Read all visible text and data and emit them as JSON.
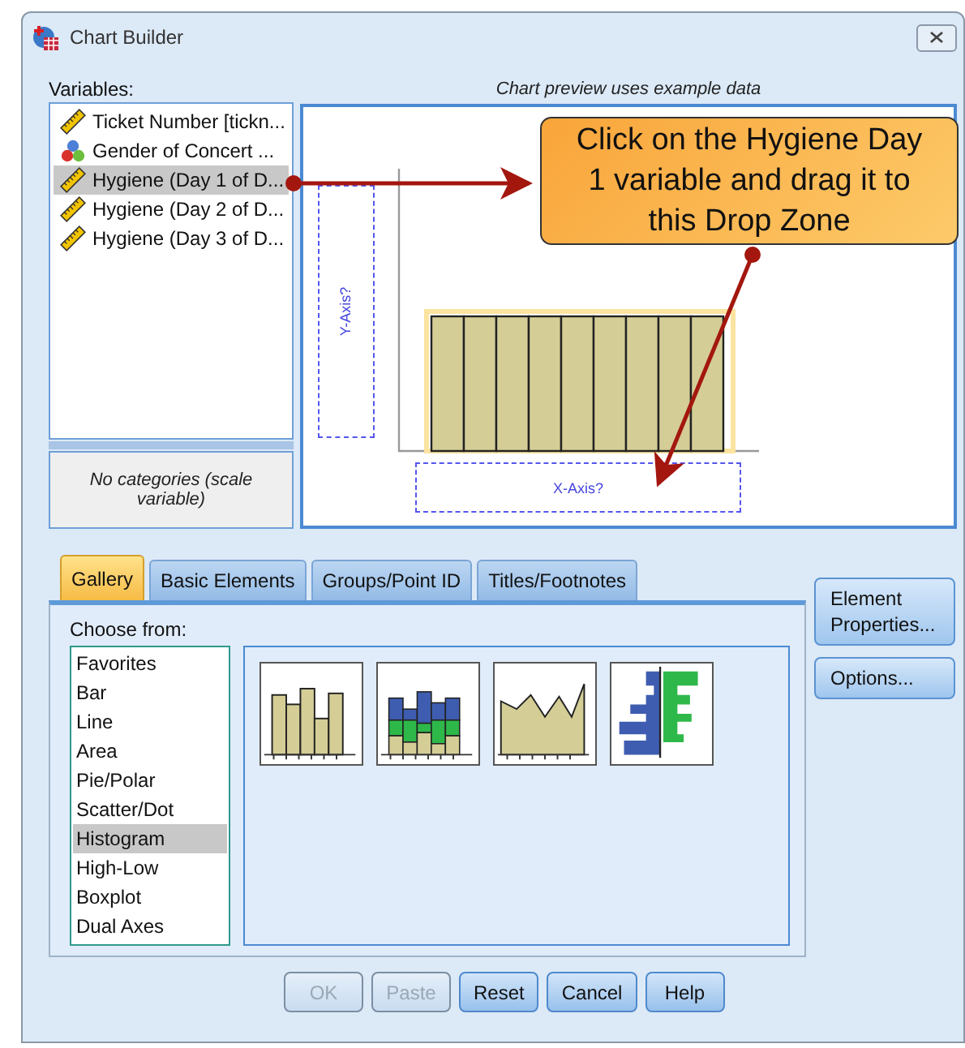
{
  "window": {
    "title": "Chart Builder"
  },
  "variables": {
    "label": "Variables:",
    "items": [
      {
        "name": "Ticket Number [tickn...",
        "kind": "scale",
        "selected": false
      },
      {
        "name": "Gender of Concert ...",
        "kind": "nominal",
        "selected": false
      },
      {
        "name": "Hygiene (Day 1 of D...",
        "kind": "scale",
        "selected": true
      },
      {
        "name": "Hygiene (Day 2 of D...",
        "kind": "scale",
        "selected": false
      },
      {
        "name": "Hygiene (Day 3 of D...",
        "kind": "scale",
        "selected": false
      }
    ]
  },
  "categories_note": "No categories (scale variable)",
  "preview": {
    "caption": "Chart preview uses example data",
    "y_zone": "Y-Axis?",
    "x_zone": "X-Axis?"
  },
  "callout": {
    "text": "Click on the Hygiene Day 1 variable and drag it to this Drop Zone"
  },
  "tabs": [
    {
      "label": "Gallery",
      "selected": true
    },
    {
      "label": "Basic Elements",
      "selected": false
    },
    {
      "label": "Groups/Point ID",
      "selected": false
    },
    {
      "label": "Titles/Footnotes",
      "selected": false
    }
  ],
  "gallery": {
    "label": "Choose from:",
    "items": [
      {
        "label": "Favorites",
        "selected": false
      },
      {
        "label": "Bar",
        "selected": false
      },
      {
        "label": "Line",
        "selected": false
      },
      {
        "label": "Area",
        "selected": false
      },
      {
        "label": "Pie/Polar",
        "selected": false
      },
      {
        "label": "Scatter/Dot",
        "selected": false
      },
      {
        "label": "Histogram",
        "selected": true
      },
      {
        "label": "High-Low",
        "selected": false
      },
      {
        "label": "Boxplot",
        "selected": false
      },
      {
        "label": "Dual Axes",
        "selected": false
      }
    ],
    "thumbnails": [
      {
        "kind": "bars"
      },
      {
        "kind": "stacked"
      },
      {
        "kind": "area"
      },
      {
        "kind": "population"
      }
    ]
  },
  "side_buttons": [
    {
      "label": "Element Properties..."
    },
    {
      "label": "Options..."
    }
  ],
  "buttons": [
    {
      "label": "OK",
      "disabled": true
    },
    {
      "label": "Paste",
      "disabled": true
    },
    {
      "label": "Reset",
      "disabled": false
    },
    {
      "label": "Cancel",
      "disabled": false
    },
    {
      "label": "Help",
      "disabled": false
    }
  ]
}
